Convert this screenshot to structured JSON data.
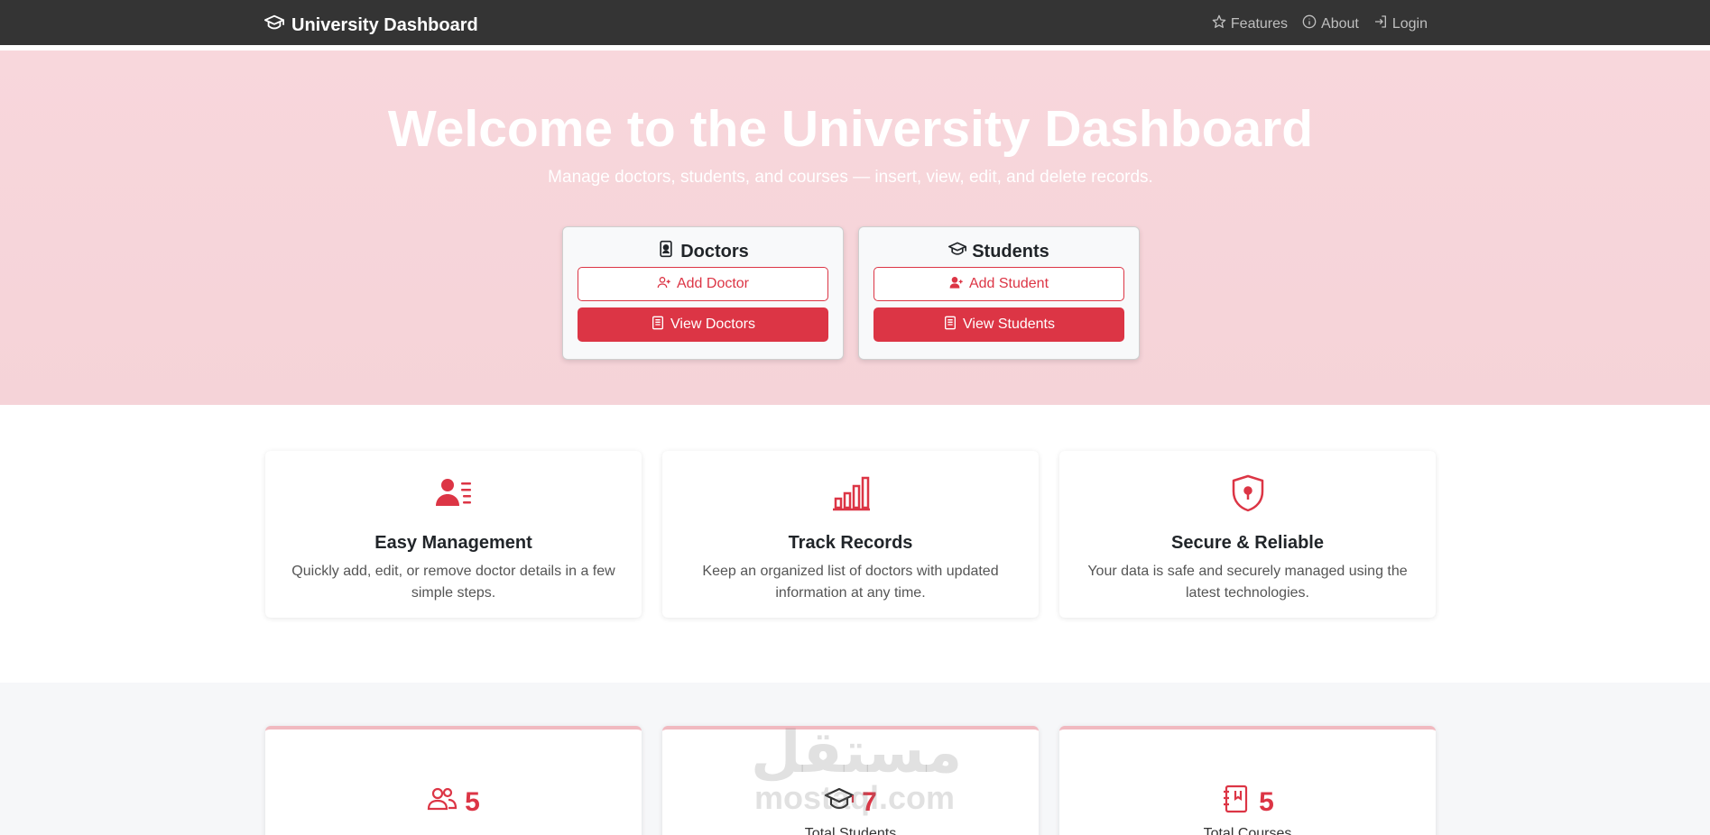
{
  "navbar": {
    "brand": "University Dashboard",
    "links": [
      {
        "label": "Features",
        "icon": "star-icon"
      },
      {
        "label": "About",
        "icon": "info-icon"
      },
      {
        "label": "Login",
        "icon": "login-icon"
      }
    ]
  },
  "hero": {
    "title": "Welcome to the University Dashboard",
    "subtitle": "Manage doctors, students, and courses — insert, view, edit, and delete records.",
    "cards": [
      {
        "title": "Doctors",
        "icon": "id-badge-icon",
        "add_label": "Add Doctor",
        "view_label": "View Doctors"
      },
      {
        "title": "Students",
        "icon": "graduation-cap-icon",
        "add_label": "Add Student",
        "view_label": "View Students"
      }
    ]
  },
  "features": [
    {
      "title": "Easy Management",
      "text": "Quickly add, edit, or remove doctor details in a few simple steps.",
      "icon": "person-lines-icon"
    },
    {
      "title": "Track Records",
      "text": "Keep an organized list of doctors with updated information at any time.",
      "icon": "bar-chart-icon"
    },
    {
      "title": "Secure & Reliable",
      "text": "Your data is safe and securely managed using the latest technologies.",
      "icon": "shield-lock-icon"
    }
  ],
  "stats": [
    {
      "value": "5",
      "label": "",
      "icon": "people-icon"
    },
    {
      "value": "7",
      "label": "Total Students",
      "icon": "graduation-cap-icon"
    },
    {
      "value": "5",
      "label": "Total Courses",
      "icon": "journal-icon"
    }
  ],
  "watermark": {
    "line1": "مستقل",
    "line2": "mostaql.com"
  },
  "colors": {
    "accent": "#dc3545",
    "navbar": "#343434",
    "hero": "#f8d7dc"
  }
}
